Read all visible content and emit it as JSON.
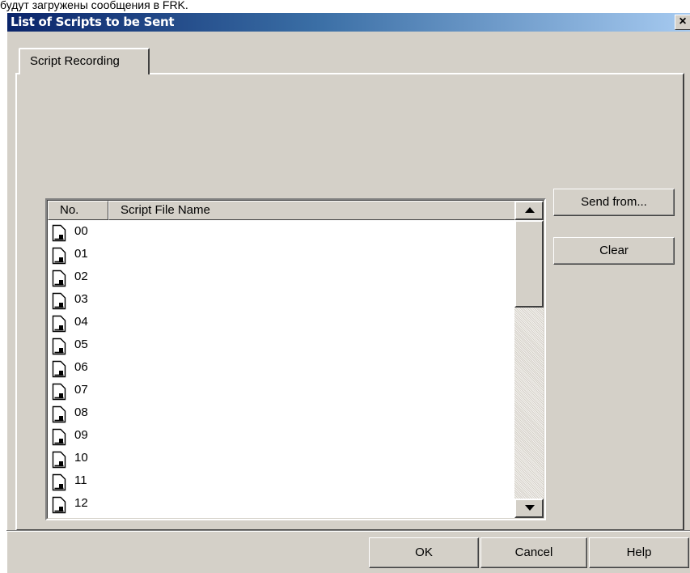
{
  "background_text": "будут загружены сообщения в FRK.",
  "dialog": {
    "title": "List of Scripts to be Sent",
    "close_glyph": "×"
  },
  "tabs": [
    {
      "label": "Script Recording"
    }
  ],
  "list": {
    "columns": [
      "No.",
      "Script File Name"
    ],
    "rows": [
      "00",
      "01",
      "02",
      "03",
      "04",
      "05",
      "06",
      "07",
      "08",
      "09",
      "10",
      "11",
      "12"
    ]
  },
  "side_buttons": {
    "send_from": "Send from...",
    "clear": "Clear"
  },
  "footer_buttons": {
    "ok": "OK",
    "cancel": "Cancel",
    "help": "Help"
  },
  "colors": {
    "titlebar_start": "#0a246a",
    "titlebar_end": "#a6caf0",
    "face": "#d4d0c8"
  }
}
